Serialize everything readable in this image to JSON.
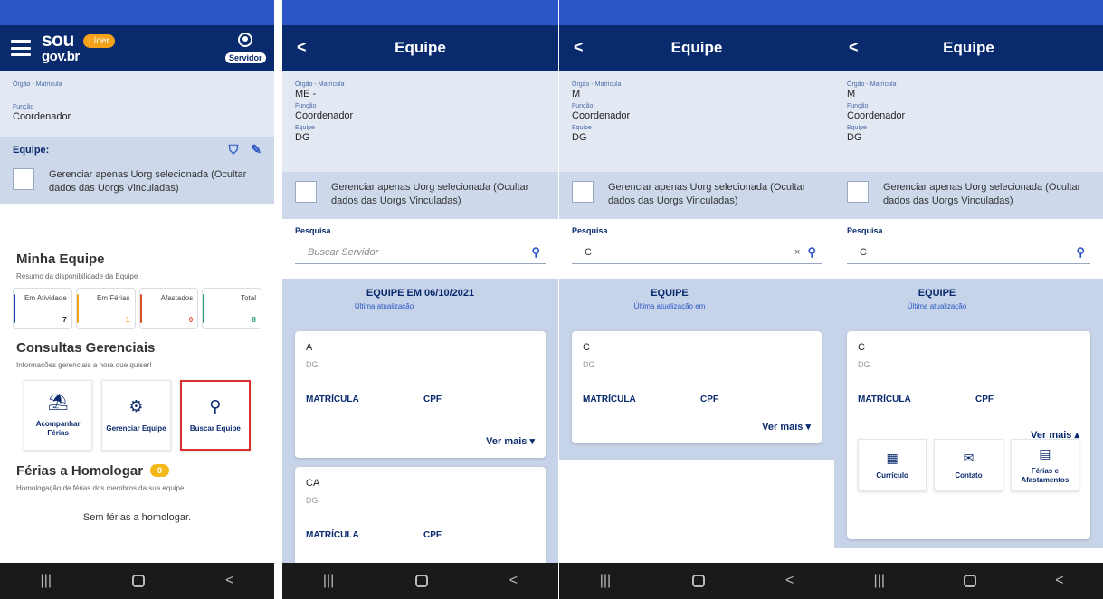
{
  "colors": {
    "header": "#0a2a6e",
    "statusbar": "#2a56c6",
    "accent": "#2a56c6",
    "highlight": "#d9302f",
    "badge": "#f4b81a"
  },
  "icons": {
    "menu": "hamburger-icon",
    "profile": "user-circle-icon",
    "filter": "filter-icon",
    "edit": "edit-icon",
    "search": "magnifier-icon",
    "back": "chevron-left-icon"
  },
  "screen1": {
    "logo_line1": "sou",
    "logo_line2": "gov.br",
    "badge": "Líder",
    "profile_label": "Servidor",
    "orgao_label": "Órgão - Matrícula",
    "funcao_label": "Função",
    "funcao_value": "Coordenador",
    "equipe_label": "Equipe:",
    "checkbox_text": "Gerenciar apenas Uorg selecionada (Ocultar dados das Uorgs Vinculadas)",
    "minha_equipe_title": "Minha Equipe",
    "minha_equipe_sub": "Resumo da disponibilidade da Equipe",
    "stats": [
      {
        "label": "Em Atividade",
        "value": "7",
        "color": "#1f4fb5"
      },
      {
        "label": "Em Férias",
        "value": "1",
        "color": "#f4a21a"
      },
      {
        "label": "Afastados",
        "value": "0",
        "color": "#e0502a"
      },
      {
        "label": "Total",
        "value": "8",
        "color": "#2a9a7a"
      }
    ],
    "consultas_title": "Consultas Gerenciais",
    "consultas_sub": "Informações gerenciais a hora que quiser!",
    "tiles": [
      {
        "label": "Acompanhar Férias",
        "icon": "umbrella-icon"
      },
      {
        "label": "Gerenciar Equipe",
        "icon": "team-settings-icon"
      },
      {
        "label": "Buscar Equipe",
        "icon": "magnifier-icon"
      }
    ],
    "ferias_title": "Férias a Homologar",
    "ferias_badge": "0",
    "ferias_sub": "Homologação de férias dos membros da sua equipe",
    "sem_ferias": "Sem férias a homologar."
  },
  "screen2": {
    "back": "<",
    "title": "Equipe",
    "orgao_label": "Órgão - Matrícula",
    "orgao_value": "ME -",
    "funcao_label": "Função",
    "funcao_value": "Coordenador",
    "equipe_label": "Equipe",
    "equipe_value": "DG",
    "checkbox_text": "Gerenciar apenas Uorg selecionada (Ocultar dados das Uorgs Vinculadas)",
    "pesquisa_label": "Pesquisa",
    "search_placeholder": "Buscar Servidor",
    "list_header": "EQUIPE EM 06/10/2021",
    "ultima": "Última atualização",
    "cards": [
      {
        "name": "A",
        "unit": "DG",
        "matricula": "MATRÍCULA",
        "cpf": "CPF",
        "ver_mais": "Ver mais"
      },
      {
        "name": "CA",
        "unit": "DG",
        "matricula": "MATRÍCULA",
        "cpf": "CPF"
      }
    ]
  },
  "screen3": {
    "back": "<",
    "title": "Equipe",
    "orgao_label": "Órgão - Matrícula",
    "orgao_value": "M",
    "funcao_label": "Função",
    "funcao_value": "Coordenador",
    "equipe_label": "Equipe",
    "equipe_value": "DG",
    "checkbox_text": "Gerenciar apenas Uorg selecionada (Ocultar dados das Uorgs Vinculadas)",
    "pesquisa_label": "Pesquisa",
    "search_value": "C",
    "clear": "×",
    "list_header": "EQUIPE",
    "ultima": "Última atualização em",
    "card": {
      "name": "C",
      "unit": "DG",
      "matricula": "MATRÍCULA",
      "cpf": "CPF",
      "ver_mais": "Ver mais"
    }
  },
  "screen4": {
    "back": "<",
    "title": "Equipe",
    "orgao_label": "Órgão - Matrícula",
    "orgao_value": "M",
    "funcao_label": "Função",
    "funcao_value": "Coordenador",
    "equipe_label": "Equipe",
    "equipe_value": "DG",
    "checkbox_text": "Gerenciar apenas Uorg selecionada (Ocultar dados das Uorgs Vinculadas)",
    "pesquisa_label": "Pesquisa",
    "search_value": "C",
    "list_header": "EQUIPE",
    "ultima": "Última atualização",
    "card": {
      "name": "C",
      "unit": "DG",
      "matricula": "MATRÍCULA",
      "cpf": "CPF",
      "ver_mais": "Ver mais"
    },
    "actions": [
      {
        "label": "Currículo",
        "icon": "graduation-cap-icon"
      },
      {
        "label": "Contato",
        "icon": "envelope-icon"
      },
      {
        "label": "Férias e Afastamentos",
        "icon": "calendar-icon"
      }
    ]
  },
  "navbar": {
    "recent": "|||",
    "back": "<"
  }
}
